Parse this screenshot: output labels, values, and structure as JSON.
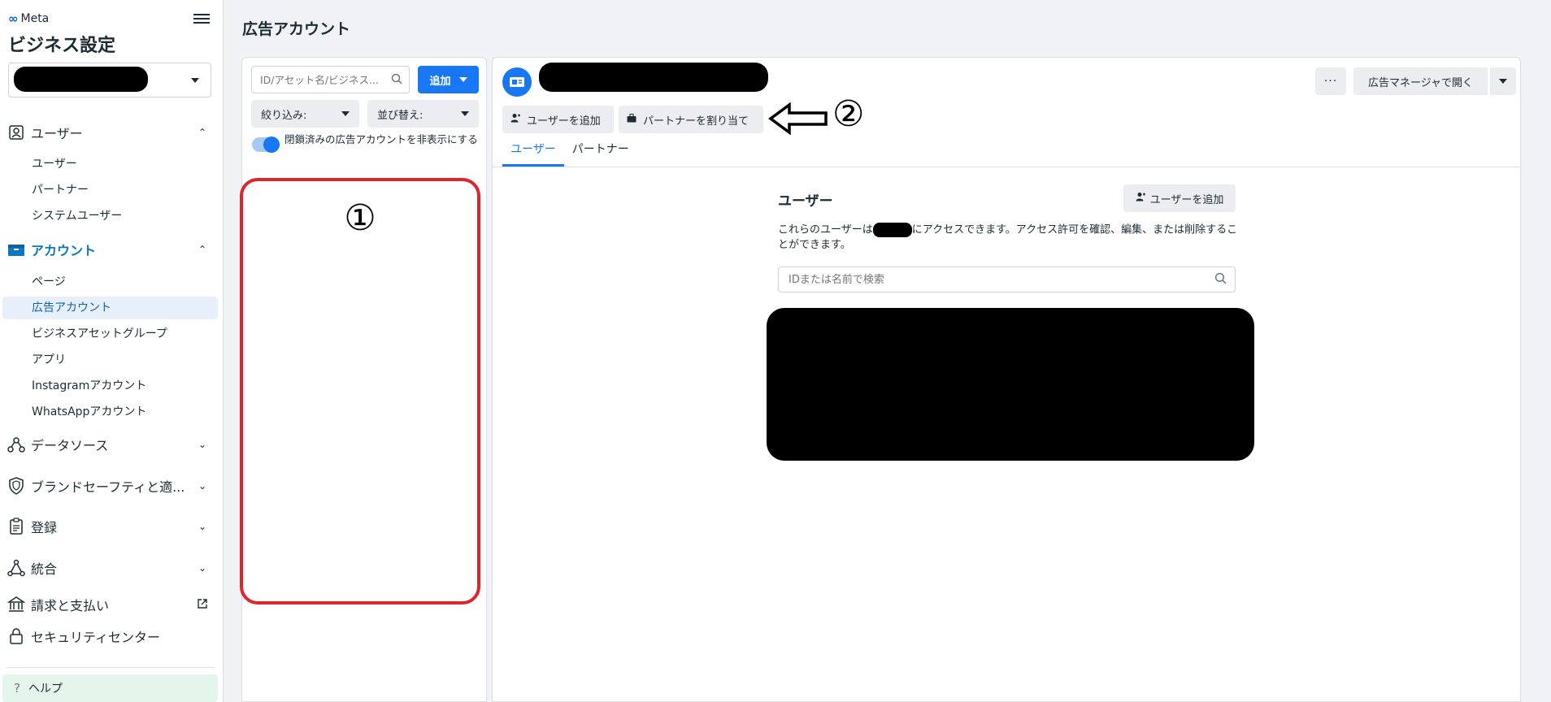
{
  "sidebar": {
    "logo_text": "Meta",
    "title": "ビジネス設定",
    "sections": {
      "users": {
        "label": "ユーザー",
        "items": [
          "ユーザー",
          "パートナー",
          "システムユーザー"
        ]
      },
      "accounts": {
        "label": "アカウント",
        "items": [
          "ページ",
          "広告アカウント",
          "ビジネスアセットグループ",
          "アプリ",
          "Instagramアカウント",
          "WhatsAppアカウント"
        ]
      },
      "data_sources": {
        "label": "データソース"
      },
      "brand_safety": {
        "label": "ブランドセーフティと適..."
      },
      "registration": {
        "label": "登録"
      },
      "integration": {
        "label": "統合"
      },
      "billing": {
        "label": "請求と支払い"
      },
      "security": {
        "label": "セキュリティセンター"
      }
    },
    "help": "ヘルプ"
  },
  "page": {
    "title": "広告アカウント"
  },
  "list_panel": {
    "search_placeholder": "ID/アセット名/ビジネス...",
    "add_label": "追加",
    "filter_label": "絞り込み:",
    "sort_label": "並び替え:",
    "toggle_label": "閉鎖済みの広告アカウントを非表示にする",
    "toggle_on": true,
    "annotation": "①"
  },
  "detail": {
    "open_in_ads_manager": "広告マネージャで開く",
    "more": "···",
    "add_user": "ユーザーを追加",
    "assign_partner": "パートナーを割り当て",
    "annotation": "②",
    "tabs": [
      "ユーザー",
      "パートナー"
    ],
    "users_title": "ユーザー",
    "users_add": "ユーザーを追加",
    "desc_prefix": "これらのユーザーは",
    "desc_suffix": "にアクセスできます。アクセス許可を確認、編集、または削除することができます。",
    "search_placeholder": "IDまたは名前で検索"
  },
  "colors": {
    "accent": "#1877f2",
    "annotation_red": "#e0242c",
    "active_nav": "#0a78be"
  }
}
